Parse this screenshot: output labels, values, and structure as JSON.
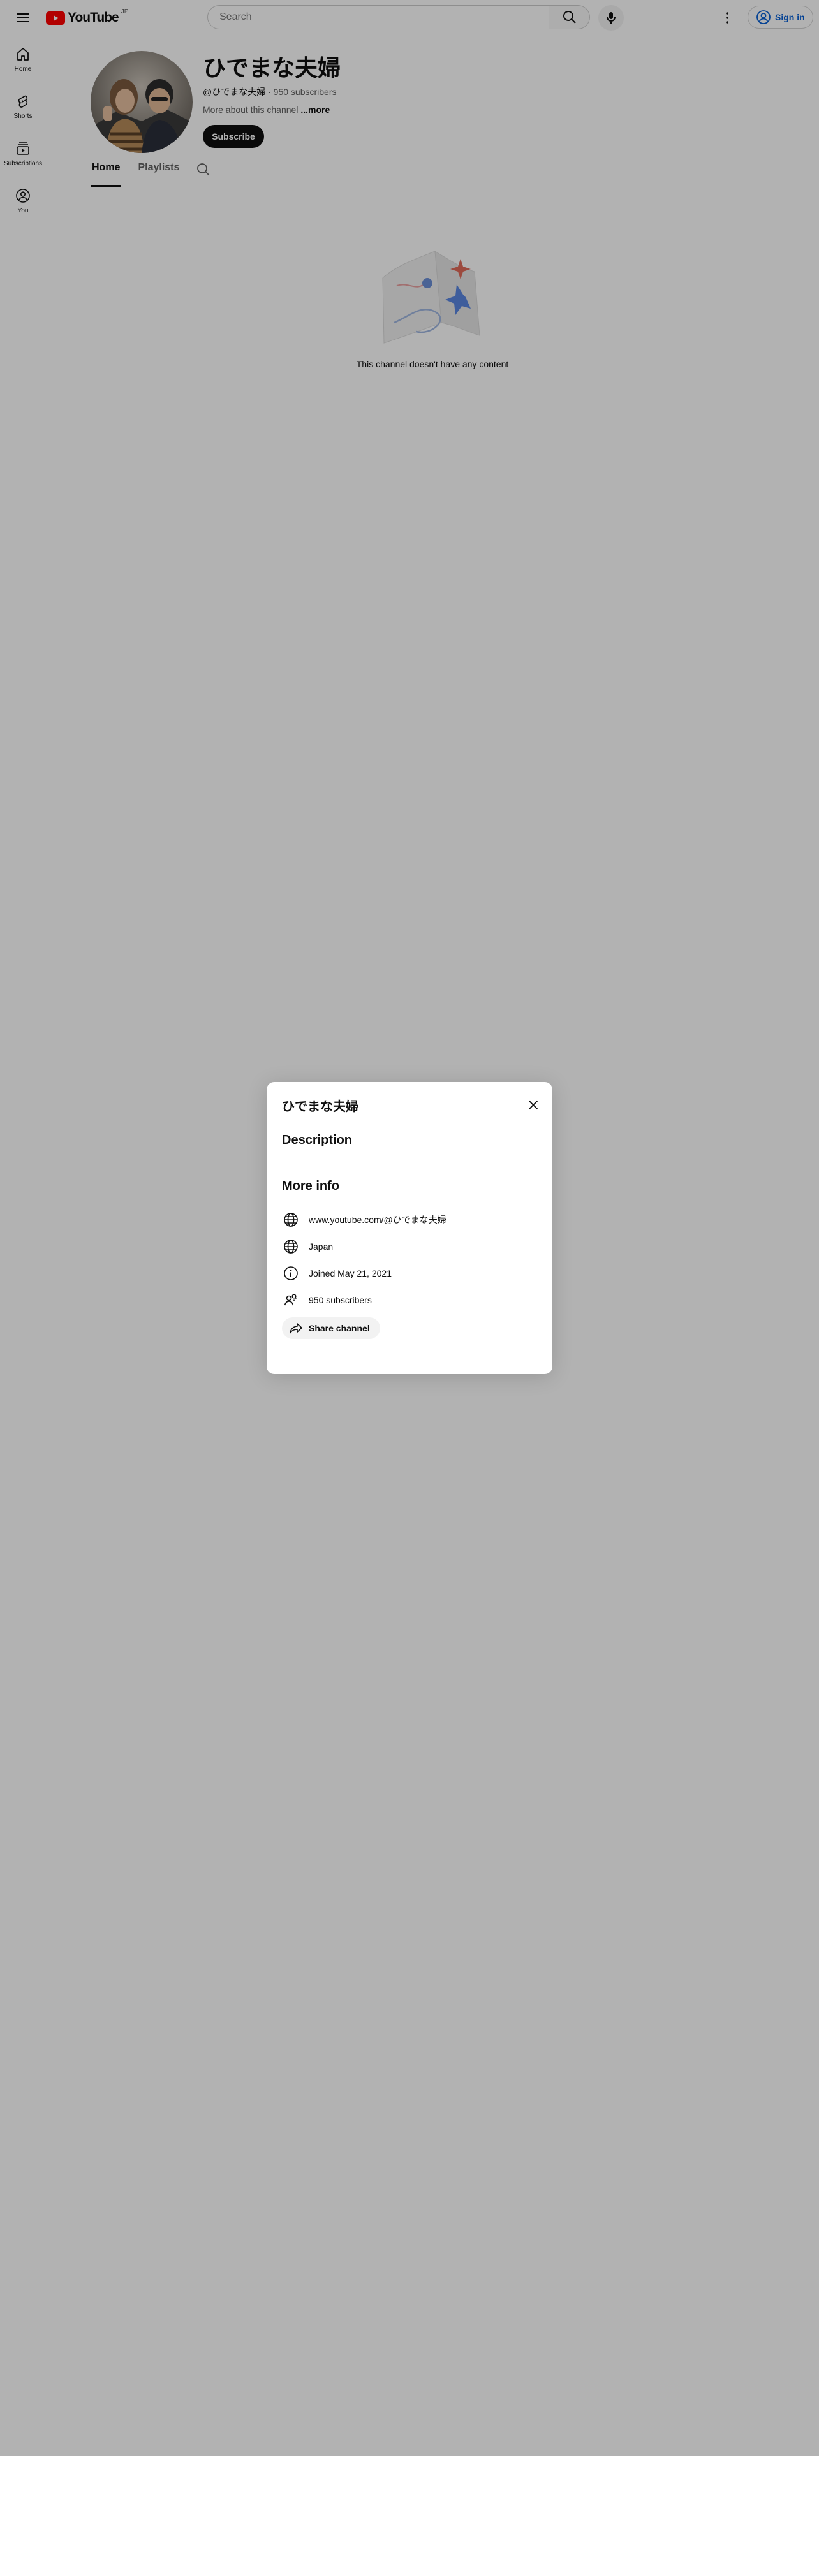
{
  "masthead": {
    "logo_text": "YouTube",
    "logo_country": "JP",
    "search_placeholder": "Search",
    "signin_label": "Sign in"
  },
  "guide": {
    "items": [
      {
        "label": "Home",
        "icon": "home-icon"
      },
      {
        "label": "Shorts",
        "icon": "shorts-icon"
      },
      {
        "label": "Subscriptions",
        "icon": "subscriptions-icon"
      },
      {
        "label": "You",
        "icon": "you-icon"
      }
    ]
  },
  "channel": {
    "title": "ひでまな夫婦",
    "handle": "@ひでまな夫婦",
    "separator": " · ",
    "subscribers": "950 subscribers",
    "description_prefix": "More about this channel",
    "more_label": " ...more",
    "subscribe_label": "Subscribe"
  },
  "tabs": [
    {
      "label": "Home",
      "active": true
    },
    {
      "label": "Playlists",
      "active": false
    }
  ],
  "empty_state": {
    "text": "This channel doesn't have any content"
  },
  "about_dialog": {
    "title": "ひでまな夫婦",
    "description_heading": "Description",
    "more_info_heading": "More info",
    "url": "www.youtube.com/@ひでまな夫婦",
    "country": "Japan",
    "joined": "Joined May 21, 2021",
    "subscribers": "950 subscribers",
    "share_label": "Share channel"
  },
  "colors": {
    "brand_red": "#ff0000",
    "link_blue": "#065fd4",
    "subscribe_bg": "#0f0f0f",
    "scrim": "rgba(0,0,0,0.30)"
  }
}
